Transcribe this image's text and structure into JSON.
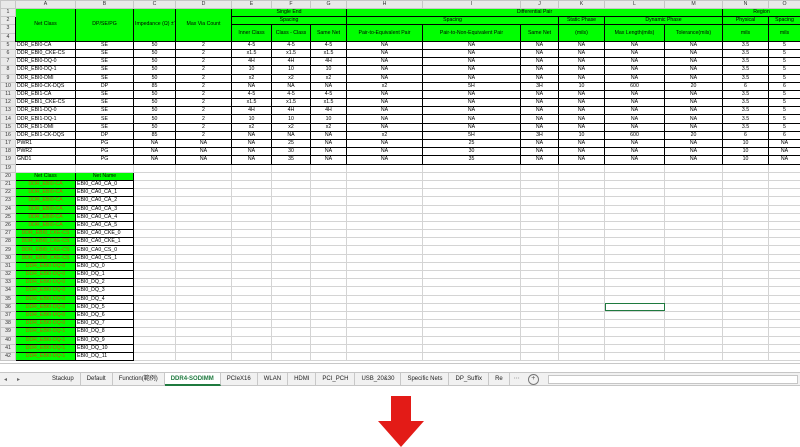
{
  "columns": [
    "A",
    "B",
    "C",
    "D",
    "E",
    "F",
    "G",
    "H",
    "I",
    "J",
    "K",
    "L",
    "M",
    "N",
    "O"
  ],
  "row_numbers": [
    "1",
    "2",
    "3",
    "4",
    "5",
    "6",
    "7",
    "8",
    "9",
    "10",
    "11",
    "12",
    "13",
    "14",
    "15",
    "16",
    "17",
    "18",
    "19",
    "20",
    "21",
    "22",
    "23",
    "24",
    "25",
    "26",
    "27",
    "28",
    "29",
    "30",
    "31",
    "32",
    "33",
    "34",
    "35",
    "36",
    "37",
    "38",
    "39",
    "40",
    "41",
    "42"
  ],
  "header": {
    "net_class": "Net Class",
    "dp_se_pg": "DP/SE/PG",
    "impedance": "Impedance (Ω) ±Tolerance (%)",
    "max_via": "Max Via Count",
    "single_end": "Single End",
    "diff_pair": "Differential Pair",
    "region": "Region",
    "spacing": "Spacing",
    "static_phase": "Static Phase",
    "dynamic_phase": "Dynamic Phase",
    "physical": "Physical",
    "spacing2": "Spacing",
    "inner_class": "Inner Class",
    "class_class": "Class - Class",
    "same_net": "Same Net",
    "pair_eq": "Pair-to-Equivalent Pair",
    "pair_noneq": "Pair-to-Non-Equivalent Pair",
    "same_net2": "Same Net",
    "mils1": "(mils)",
    "max_length": "Max Length(mils)",
    "tolerance": "Tolerance(mils)",
    "mils2": "mils",
    "mils3": "mils"
  },
  "rows": [
    [
      "DDR_EBI0-CA",
      "SE",
      "50",
      "2",
      "4-5",
      "4-5",
      "4-5",
      "NA",
      "NA",
      "NA",
      "NA",
      "NA",
      "NA",
      "3.5",
      "5"
    ],
    [
      "DDR_EBI0_CKE-CS",
      "SE",
      "50",
      "2",
      "x1.5",
      "x1.5",
      "x1.5",
      "NA",
      "NA",
      "NA",
      "NA",
      "NA",
      "NA",
      "3.5",
      "5"
    ],
    [
      "DDR_EBI0-DQ-0",
      "SE",
      "50",
      "2",
      "4H",
      "4H",
      "4H",
      "NA",
      "NA",
      "NA",
      "NA",
      "NA",
      "NA",
      "3.5",
      "5"
    ],
    [
      "DDR_EBI0-DQ-1",
      "SE",
      "50",
      "2",
      "10",
      "10",
      "10",
      "NA",
      "NA",
      "NA",
      "NA",
      "NA",
      "NA",
      "3.5",
      "5"
    ],
    [
      "DDR_EBI0-DMI",
      "SE",
      "50",
      "2",
      "x2",
      "x2",
      "x2",
      "NA",
      "NA",
      "NA",
      "NA",
      "NA",
      "NA",
      "3.5",
      "5"
    ],
    [
      "DDR_EBI0-CK-DQS",
      "DP",
      "85",
      "2",
      "NA",
      "NA",
      "NA",
      "x2",
      "5H",
      "3H",
      "10",
      "600",
      "20",
      "6",
      "6"
    ],
    [
      "DDR_EBI1-CA",
      "SE",
      "50",
      "2",
      "4-5",
      "4-5",
      "4-5",
      "NA",
      "NA",
      "NA",
      "NA",
      "NA",
      "NA",
      "3.5",
      "5"
    ],
    [
      "DDR_EBI1_CKE-CS",
      "SE",
      "50",
      "2",
      "x1.5",
      "x1.5",
      "x1.5",
      "NA",
      "NA",
      "NA",
      "NA",
      "NA",
      "NA",
      "3.5",
      "5"
    ],
    [
      "DDR_EBI1-DQ-0",
      "SE",
      "50",
      "2",
      "4H",
      "4H",
      "4H",
      "NA",
      "NA",
      "NA",
      "NA",
      "NA",
      "NA",
      "3.5",
      "5"
    ],
    [
      "DDR_EBI1-DQ-1",
      "SE",
      "50",
      "2",
      "10",
      "10",
      "10",
      "NA",
      "NA",
      "NA",
      "NA",
      "NA",
      "NA",
      "3.5",
      "5"
    ],
    [
      "DDR_EBI1-DMI",
      "SE",
      "50",
      "2",
      "x2",
      "x2",
      "x2",
      "NA",
      "NA",
      "NA",
      "NA",
      "NA",
      "NA",
      "3.5",
      "5"
    ],
    [
      "DDR_EBI1-CK-DQS",
      "DP",
      "85",
      "2",
      "NA",
      "NA",
      "NA",
      "x2",
      "5H",
      "3H",
      "10",
      "600",
      "20",
      "6",
      "6"
    ],
    [
      "PWR1",
      "PG",
      "NA",
      "NA",
      "NA",
      "25",
      "NA",
      "NA",
      "25",
      "NA",
      "NA",
      "NA",
      "NA",
      "10",
      "NA"
    ],
    [
      "PWR2",
      "PG",
      "NA",
      "NA",
      "NA",
      "30",
      "NA",
      "NA",
      "30",
      "NA",
      "NA",
      "NA",
      "NA",
      "10",
      "NA"
    ],
    [
      "GND1",
      "PG",
      "NA",
      "NA",
      "NA",
      "35",
      "NA",
      "NA",
      "35",
      "NA",
      "NA",
      "NA",
      "NA",
      "10",
      "NA"
    ]
  ],
  "list_header": {
    "net_class": "Net Class",
    "net_name": "Net Name"
  },
  "net_list": [
    [
      "DDR_EBI0-CA",
      "EBI0_CA0_CA_0"
    ],
    [
      "DDR_EBI0-CA",
      "EBI0_CA0_CA_1"
    ],
    [
      "DDR_EBI0-CA",
      "EBI0_CA0_CA_2"
    ],
    [
      "DDR_EBI0-CA",
      "EBI0_CA0_CA_3"
    ],
    [
      "DDR_EBI0-CA",
      "EBI0_CA0_CA_4"
    ],
    [
      "DDR_EBI0-CA",
      "EBI0_CA0_CA_5"
    ],
    [
      "DDR_EBI0_CKE-CS",
      "EBI0_CA0_CKE_0"
    ],
    [
      "DDR_EBI0_CKE-CS",
      "EBI0_CA0_CKE_1"
    ],
    [
      "DDR_EBI0_CKE-CS",
      "EBI0_CA0_CS_0"
    ],
    [
      "DDR_EBI0_CKE-CS",
      "EBI0_CA0_CS_1"
    ],
    [
      "DDR_EBI0-DQ-0",
      "EBI0_DQ_0"
    ],
    [
      "DDR_EBI0-DQ-0",
      "EBI0_DQ_1"
    ],
    [
      "DDR_EBI0-DQ-0",
      "EBI0_DQ_2"
    ],
    [
      "DDR_EBI0-DQ-0",
      "EBI0_DQ_3"
    ],
    [
      "DDR_EBI0-DQ-0",
      "EBI0_DQ_4"
    ],
    [
      "DDR_EBI0-DQ-0",
      "EBI0_DQ_5"
    ],
    [
      "DDR_EBI0-DQ-0",
      "EBI0_DQ_6"
    ],
    [
      "DDR_EBI0-DQ-0",
      "EBI0_DQ_7"
    ],
    [
      "DDR_EBI0-DQ-1",
      "EBI0_DQ_8"
    ],
    [
      "DDR_EBI0-DQ-1",
      "EBI0_DQ_9"
    ],
    [
      "DDR_EBI0-DQ-1",
      "EBI0_DQ_10"
    ],
    [
      "DDR_EBI0-DQ-1",
      "EBI0_DQ_11"
    ]
  ],
  "tabs": [
    "Stackup",
    "Default",
    "Function(範例)",
    "DDR4-SODIMM",
    "PCIeX16",
    "WLAN",
    "HDMI",
    "PCI_PCH",
    "USB_20&30",
    "Specific Nets",
    "DP_Suffix",
    "Re"
  ],
  "active_tab": "DDR4-SODIMM",
  "nav": {
    "first": "◂",
    "last": "▸"
  },
  "tab_add": "+",
  "tab_more": "⋯",
  "colors": {
    "header_green": "#00ff00",
    "active_tab": "#1f7a3f",
    "class_text": "#c05a00",
    "arrow": "#e31b17"
  },
  "arrow_icon": "down-arrow"
}
